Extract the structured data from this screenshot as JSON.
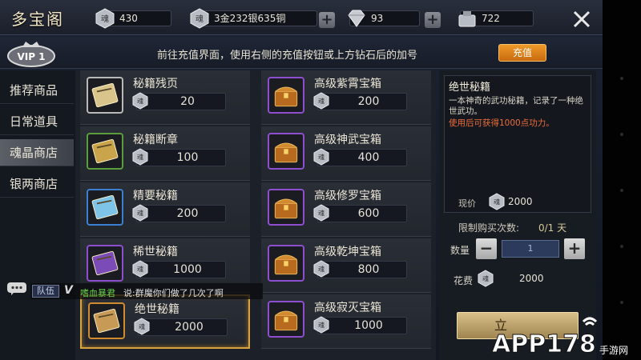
{
  "header": {
    "title": "多宝阁",
    "resources": [
      {
        "icon": "soul-icon",
        "value": "430"
      },
      {
        "icon": "soul-icon",
        "value": "3金232银635铜"
      },
      {
        "icon": "diamond-icon",
        "value": "93"
      },
      {
        "icon": "money-bag-icon",
        "value": "722"
      }
    ]
  },
  "vipbar": {
    "vip_badge": "VIP 1",
    "notice": "前往充值界面，使用右侧的充值按钮或上方钻石后的加号",
    "recharge_label": "充值"
  },
  "sidebar": {
    "tabs": [
      {
        "label": "推荐商品",
        "active": false
      },
      {
        "label": "日常道具",
        "active": false
      },
      {
        "label": "魂晶商店",
        "active": true
      },
      {
        "label": "银两商店",
        "active": false
      }
    ]
  },
  "items": [
    {
      "name": "秘籍残页",
      "price": "20",
      "icon": "scroll-icon",
      "frame": "#b9b9b9"
    },
    {
      "name": "秘籍断章",
      "price": "100",
      "icon": "green-scroll-icon",
      "frame": "#5a9d3d"
    },
    {
      "name": "精要秘籍",
      "price": "200",
      "icon": "blue-scroll-icon",
      "frame": "#3b7fd0"
    },
    {
      "name": "稀世秘籍",
      "price": "1000",
      "icon": "purple-book-icon",
      "frame": "#8d4fd0"
    },
    {
      "name": "绝世秘籍",
      "price": "2000",
      "icon": "gold-book-icon",
      "frame": "#d08b2f"
    },
    {
      "name": "高级紫霄宝箱",
      "price": "200",
      "icon": "chest-icon",
      "frame": "#8d4fd0"
    },
    {
      "name": "高级神武宝箱",
      "price": "400",
      "icon": "chest-icon",
      "frame": "#8d4fd0"
    },
    {
      "name": "高级修罗宝箱",
      "price": "600",
      "icon": "chest-icon",
      "frame": "#8d4fd0"
    },
    {
      "name": "高级乾坤宝箱",
      "price": "800",
      "icon": "chest-icon",
      "frame": "#8d4fd0"
    },
    {
      "name": "高级寂灭宝箱",
      "price": "1000",
      "icon": "chest-icon",
      "frame": "#8d4fd0"
    }
  ],
  "detail": {
    "title": "绝世秘籍",
    "description": "一本神奇的武功秘籍，记录了一种绝世武功。",
    "effect": "使用后可获得1000点功力。",
    "current_price_label": "现价",
    "current_price": "2000",
    "limit_label": "限制购买次数:",
    "limit_value": "0/1 天",
    "quantity_label": "数量",
    "quantity": "1",
    "cost_label": "花费",
    "cost": "2000",
    "buy_label": "立"
  },
  "chat": {
    "channel": "队伍",
    "vip": "V",
    "sender": "嗜血暴君",
    "message": "说:群魔你们做了几次了啊"
  },
  "watermark": {
    "brand": "APP178",
    "suffix": "手游网"
  }
}
